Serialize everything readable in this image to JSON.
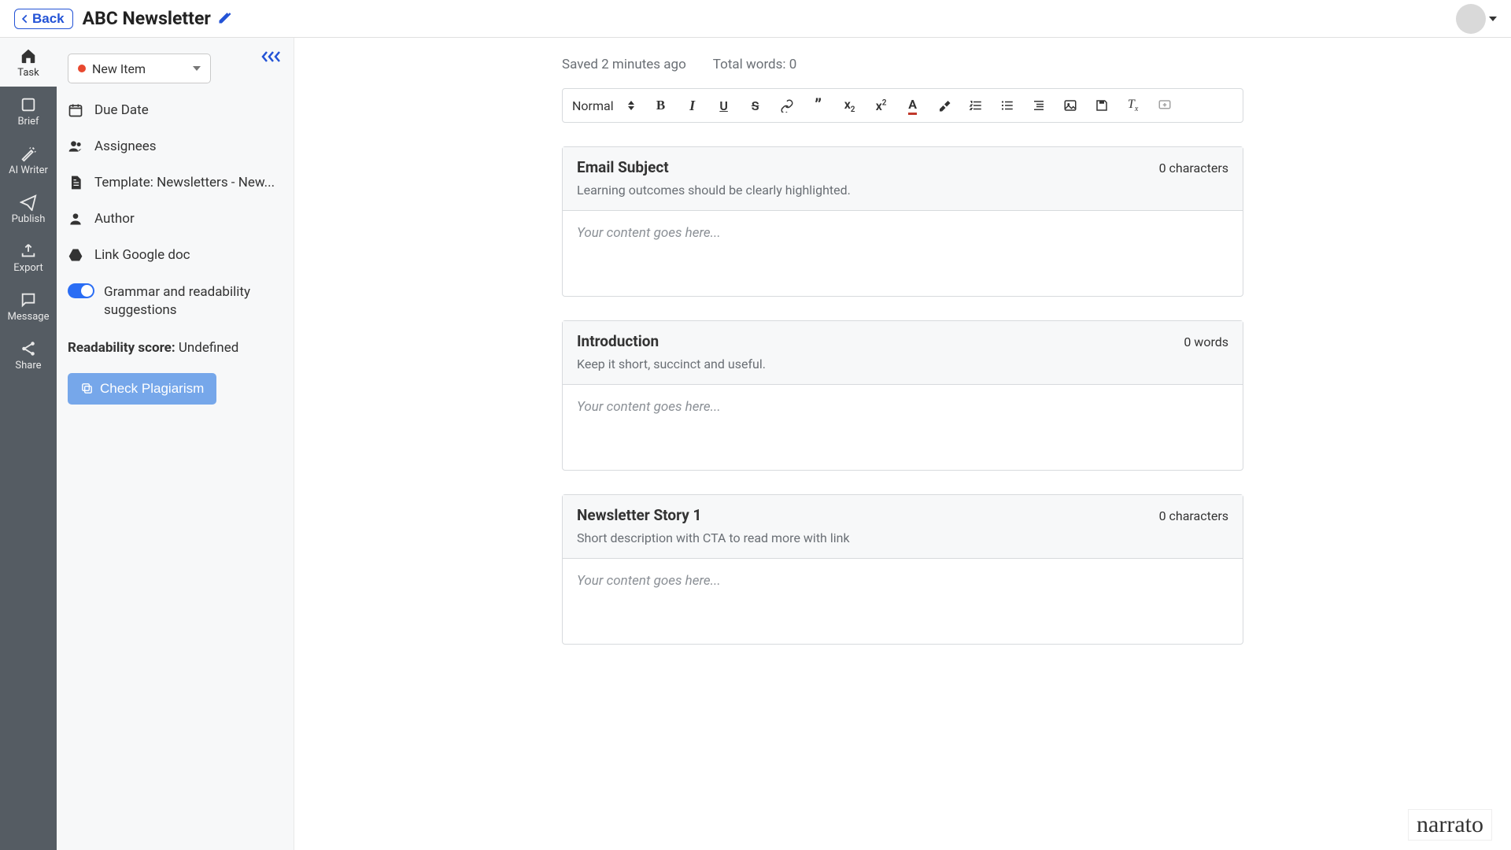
{
  "topbar": {
    "back_label": "Back",
    "title": "ABC Newsletter"
  },
  "nav": {
    "items": [
      {
        "label": "Task"
      },
      {
        "label": "Brief"
      },
      {
        "label": "AI Writer"
      },
      {
        "label": "Publish"
      },
      {
        "label": "Export"
      },
      {
        "label": "Message"
      },
      {
        "label": "Share"
      }
    ]
  },
  "side": {
    "status_label": "New Item",
    "due_date": "Due Date",
    "assignees": "Assignees",
    "template": "Template: Newsletters - New...",
    "author": "Author",
    "gdoc": "Link Google doc",
    "grammar_toggle": "Grammar and readability suggestions",
    "readability_label": "Readability score:",
    "readability_value": "Undefined",
    "plagiarism_btn": "Check Plagiarism"
  },
  "editor": {
    "saved": "Saved 2 minutes ago",
    "total_words": "Total words: 0",
    "toolbar": {
      "style": "Normal"
    },
    "placeholder": "Your content goes here...",
    "blocks": [
      {
        "title": "Email Subject",
        "hint": "Learning outcomes should be clearly highlighted.",
        "counter": "0 characters"
      },
      {
        "title": "Introduction",
        "hint": "Keep it short, succinct and useful.",
        "counter": "0 words"
      },
      {
        "title": "Newsletter Story 1",
        "hint": "Short description with CTA to read more with link",
        "counter": "0 characters"
      }
    ]
  },
  "brand": "narrato"
}
